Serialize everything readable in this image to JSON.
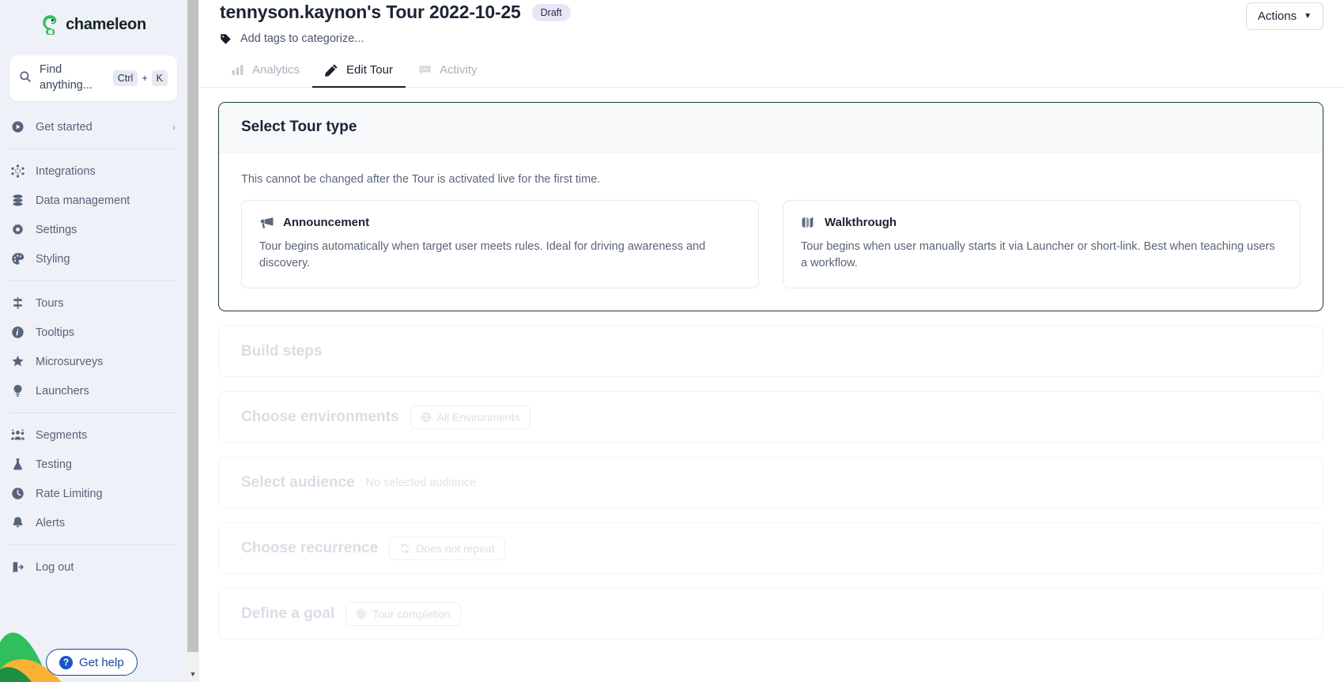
{
  "brand": {
    "name": "chameleon",
    "logo_icon": "chameleon-logo-icon",
    "green": "#2fbf5d",
    "dark": "#16271f"
  },
  "sidebar": {
    "search": {
      "placeholder": "Find anything...",
      "icon": "search-icon",
      "shortcut_keys": [
        "Ctrl",
        "K"
      ],
      "plus": "+"
    },
    "items": [
      {
        "label": "Get started",
        "icon": "play-circle-icon",
        "chevron": "›"
      },
      {
        "label": "Integrations",
        "icon": "integrations-icon"
      },
      {
        "label": "Data management",
        "icon": "database-icon"
      },
      {
        "label": "Settings",
        "icon": "gear-icon"
      },
      {
        "label": "Styling",
        "icon": "palette-icon"
      },
      {
        "label": "Tours",
        "icon": "tours-icon"
      },
      {
        "label": "Tooltips",
        "icon": "info-icon"
      },
      {
        "label": "Microsurveys",
        "icon": "star-icon"
      },
      {
        "label": "Launchers",
        "icon": "lightbulb-icon"
      },
      {
        "label": "Segments",
        "icon": "people-icon"
      },
      {
        "label": "Testing",
        "icon": "flask-icon"
      },
      {
        "label": "Rate Limiting",
        "icon": "clock-icon"
      },
      {
        "label": "Alerts",
        "icon": "bell-icon"
      },
      {
        "label": "Log out",
        "icon": "logout-icon"
      }
    ],
    "get_help": {
      "label": "Get help",
      "icon": "question-mark-icon",
      "color": "#14489e"
    }
  },
  "header": {
    "title": "tennyson.kaynon's Tour 2022-10-25",
    "status": "Draft",
    "status_bg": "#e7e5f6",
    "tags_placeholder": "Add tags to categorize...",
    "tags_icon": "tag-icon",
    "actions_label": "Actions",
    "actions_caret": "▼"
  },
  "tabs": [
    {
      "label": "Analytics",
      "icon": "bar-chart-icon",
      "active": false
    },
    {
      "label": "Edit Tour",
      "icon": "pencil-icon",
      "active": true
    },
    {
      "label": "Activity",
      "icon": "comment-icon",
      "active": false
    }
  ],
  "tour_type_card": {
    "title": "Select Tour type",
    "description": "This cannot be changed after the Tour is activated live for the first time.",
    "border_color": "#1d3b33",
    "options": [
      {
        "name": "Announcement",
        "icon": "megaphone-icon",
        "description": "Tour begins automatically when target user meets rules. Ideal for driving awareness and discovery."
      },
      {
        "name": "Walkthrough",
        "icon": "walkthrough-icon",
        "description": "Tour begins when user manually starts it via Launcher or short-link. Best when teaching users a workflow."
      }
    ]
  },
  "collapsed_sections": [
    {
      "title": "Build steps",
      "sub": "",
      "chip": "",
      "chip_icon": ""
    },
    {
      "title": "Choose environments",
      "sub": "",
      "chip": "All Environments",
      "chip_icon": "globe-icon"
    },
    {
      "title": "Select audience",
      "sub": "No selected audience",
      "chip": "",
      "chip_icon": ""
    },
    {
      "title": "Choose recurrence",
      "sub": "",
      "chip": "Does not repeat",
      "chip_icon": "repeat-icon"
    },
    {
      "title": "Define a goal",
      "sub": "",
      "chip": "Tour completion",
      "chip_icon": "target-icon"
    }
  ],
  "scrollbar": {
    "arrow": "▼"
  }
}
